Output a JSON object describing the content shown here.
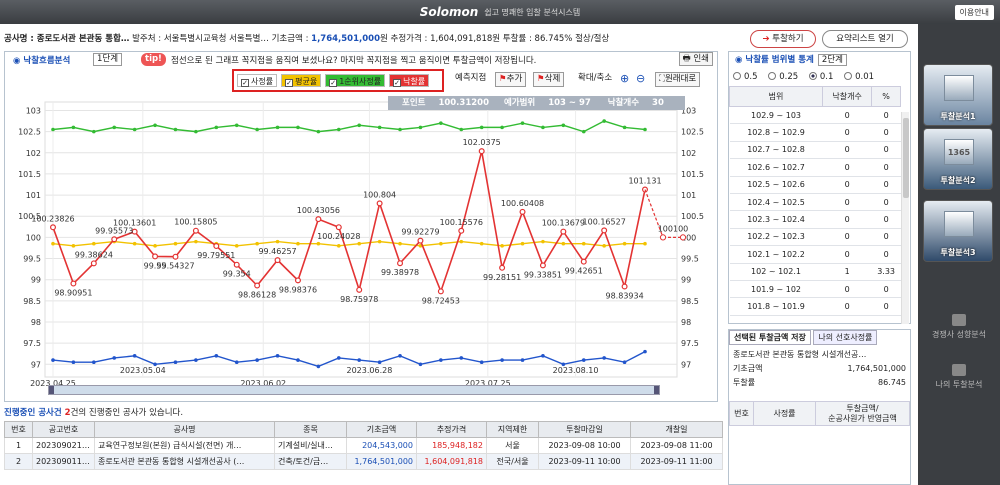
{
  "title_bar": {
    "brand": "Solomon",
    "tagline": "쉽고 명쾌한 입찰 분석시스템",
    "help_label": "이용안내"
  },
  "info_bar": {
    "name_label": "공사명 : ",
    "name": "종로도서관 본관동 통합…",
    "issuer_label": "발주처 : ",
    "issuer": "서울특별시교육청 서울특별…",
    "base_label": "기초금액 : ",
    "base_amount": "1,764,501,000",
    "won": "원",
    "est_label": "추정가격 : ",
    "est_price": "1,604,091,818원",
    "rate_label": "투찰률 : ",
    "rate": "86.745%",
    "method": "절상/절상"
  },
  "top_buttons": {
    "bid": "투찰하기",
    "summary": "요약리스트 열기"
  },
  "chart_header": {
    "title": "낙찰흐름분석",
    "level": "1단계",
    "tip": "tip!",
    "message": "점선으로 된 그래프 꼭지점을 움직여 보셨나요? 마지막 꼭지점을 찍고 움직이면 투찰금액이 저장됩니다.",
    "print": "인쇄"
  },
  "legend": [
    {
      "label": "사정률",
      "color": "#ffffff"
    },
    {
      "label": "평균율",
      "color": "#f2c200"
    },
    {
      "label": "1순위사정률",
      "color": "#33bb33"
    },
    {
      "label": "낙찰률",
      "color": "#e33333"
    }
  ],
  "tools": {
    "predict": "예측지점",
    "add": "추가",
    "delete": "삭제",
    "zoom": "확대/축소",
    "reset": "원래대로"
  },
  "info_line": {
    "point_label": "포인트",
    "point": "100.31200",
    "range_label": "예가범위",
    "range": "103 ~ 97",
    "count_label": "낙찰개수",
    "count": "30"
  },
  "chart_data": {
    "type": "line",
    "ylim": [
      96.7,
      103.2
    ],
    "yticks": [
      "103",
      "102.5",
      "102",
      "101.5",
      "101",
      "100.5",
      "100",
      "99.5",
      "99",
      "98.5",
      "98",
      "97.5",
      "97"
    ],
    "xticks": [
      "2023.04.25",
      "2023.05.04",
      "2023.06.02",
      "2023.06.28",
      "2023.07.25",
      "2023.08.10"
    ],
    "series": [
      {
        "name": "1순위사정률",
        "color": "#33bb33",
        "values": [
          102.55,
          102.6,
          102.5,
          102.6,
          102.55,
          102.65,
          102.55,
          102.5,
          102.6,
          102.65,
          102.55,
          102.6,
          102.6,
          102.5,
          102.55,
          102.65,
          102.6,
          102.55,
          102.6,
          102.7,
          102.55,
          102.6,
          102.6,
          102.7,
          102.6,
          102.65,
          102.5,
          102.75,
          102.6,
          102.55
        ]
      },
      {
        "name": "평균율",
        "color": "#f2c200",
        "values": [
          99.85,
          99.8,
          99.85,
          99.9,
          99.85,
          99.8,
          99.85,
          99.9,
          99.85,
          99.8,
          99.85,
          99.9,
          99.85,
          99.85,
          99.8,
          99.85,
          99.9,
          99.85,
          99.8,
          99.85,
          99.9,
          99.85,
          99.8,
          99.85,
          99.9,
          99.85,
          99.85,
          99.8,
          99.85,
          99.85
        ]
      },
      {
        "name": "낙찰률",
        "color": "#e33333",
        "values": [
          100.23826,
          98.90951,
          99.38624,
          99.95573,
          100.13601,
          99.55,
          99.54327,
          100.15805,
          99.79551,
          99.354,
          98.86128,
          99.46257,
          98.98376,
          100.43056,
          100.24028,
          98.75978,
          100.804,
          99.38978,
          99.92279,
          98.72453,
          100.15576,
          102.0375,
          99.28151,
          100.60408,
          99.33851,
          100.13679,
          99.42651,
          100.16527,
          98.83934,
          101.131
        ]
      },
      {
        "name": "사정률",
        "color": "#2255cc",
        "values": [
          97.1,
          97.05,
          97.05,
          97.15,
          97.2,
          97.0,
          97.05,
          97.1,
          97.2,
          97.05,
          97.1,
          97.2,
          97.1,
          96.95,
          97.15,
          97.1,
          97.05,
          97.2,
          97.0,
          97.1,
          97.15,
          97.05,
          97.1,
          97.1,
          97.2,
          97.0,
          97.1,
          97.15,
          97.05,
          97.3
        ]
      }
    ],
    "point_labels": [
      "100.23826",
      "98.90951",
      "99.38624",
      "99.95573",
      "100.13601",
      "99.55",
      "99.54327",
      "100.15805",
      "99.79551",
      "99.354",
      "98.86128",
      "99.46257",
      "98.98376",
      "100.43056",
      "100.24028",
      "98.75978",
      "100.804",
      "99.38978",
      "99.92279",
      "98.72453",
      "100.15576",
      "102.0375",
      "99.28151",
      "100.60408",
      "99.33851",
      "100.13679",
      "99.42651",
      "100.16527",
      "98.83934",
      "101.131"
    ],
    "dashed_point": {
      "value": 100.0,
      "label": "100100"
    }
  },
  "range_panel": {
    "title": "낙찰률 범위별 통계",
    "level": "2단계",
    "steps": [
      "0.5",
      "0.25",
      "0.1",
      "0.01"
    ],
    "selected_step": "0.1",
    "columns": [
      "범위",
      "낙찰개수",
      "%"
    ],
    "rows": [
      [
        "102.9 ~ 103",
        "0",
        "0"
      ],
      [
        "102.8 ~ 102.9",
        "0",
        "0"
      ],
      [
        "102.7 ~ 102.8",
        "0",
        "0"
      ],
      [
        "102.6 ~ 102.7",
        "0",
        "0"
      ],
      [
        "102.5 ~ 102.6",
        "0",
        "0"
      ],
      [
        "102.4 ~ 102.5",
        "0",
        "0"
      ],
      [
        "102.3 ~ 102.4",
        "0",
        "0"
      ],
      [
        "102.2 ~ 102.3",
        "0",
        "0"
      ],
      [
        "102.1 ~ 102.2",
        "0",
        "0"
      ],
      [
        "102 ~ 102.1",
        "1",
        "3.33"
      ],
      [
        "101.9 ~ 102",
        "0",
        "0"
      ],
      [
        "101.8 ~ 101.9",
        "0",
        "0"
      ]
    ]
  },
  "selected_panel": {
    "tabs": [
      "선택된 투찰금액 저장",
      "나의 선호사정률"
    ],
    "project": "종로도서관 본관동 통합형 시설개선공…",
    "base_label": "기초금액",
    "base_value": "1,764,501,000",
    "rate_label": "투찰률",
    "rate_value": "86.745",
    "columns": [
      "번호",
      "사정률",
      "투찰금액/\n순공사원가 반영금액"
    ]
  },
  "projects": {
    "title": "진행중인 공사건",
    "count": "2",
    "rest": "건의 진행중인 공사가 있습니다.",
    "columns": [
      "번호",
      "공고번호",
      "공사명",
      "종목",
      "기초금액",
      "추정가격",
      "지역제한",
      "투찰마감일",
      "개찰일"
    ],
    "rows": [
      [
        "1",
        "2023090219…",
        "교육연구정보원(본원) 급식시설(전면) 개…",
        "기계설비/실내…",
        "204,543,000",
        "185,948,182",
        "서울",
        "2023-09-08 10:00",
        "2023-09-08 11:00"
      ],
      [
        "2",
        "2023090112…",
        "종로도서관 본관동 통합형 시설개선공사 (…",
        "건축/토건/금…",
        "1,764,501,000",
        "1,604,091,818",
        "전국/서울",
        "2023-09-11 10:00",
        "2023-09-11 11:00"
      ]
    ]
  },
  "sidebar": {
    "btn1": "투찰분석",
    "btn2": "투찰분석",
    "btn3": "투찰분석",
    "icon2_text": "1365",
    "nav1": "경쟁사 성향분석",
    "nav2": "나의 투찰분석",
    "digits": [
      "1",
      "2",
      "3"
    ]
  }
}
